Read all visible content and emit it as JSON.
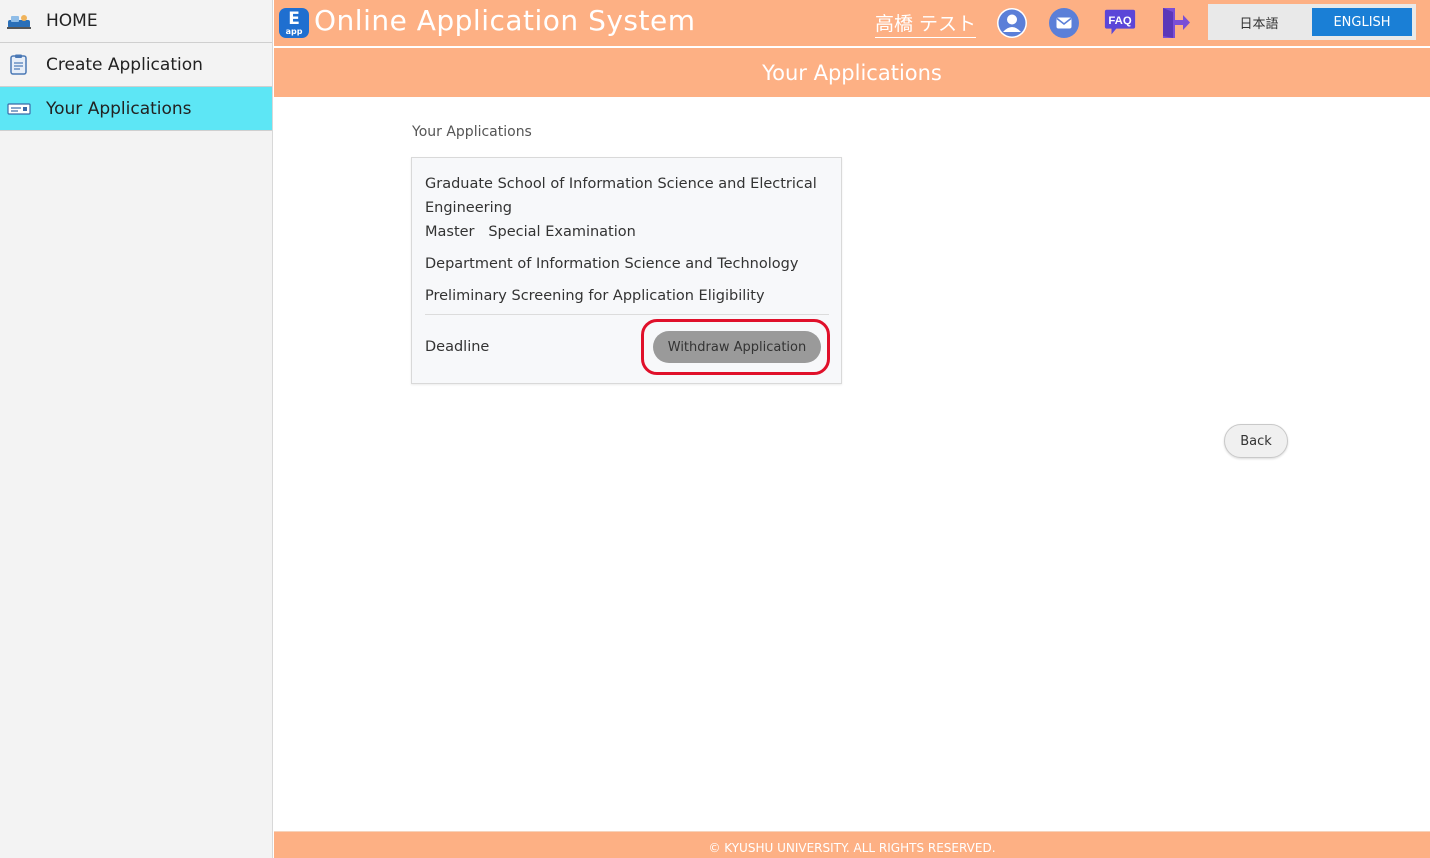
{
  "sidebar": {
    "items": [
      {
        "label": "HOME",
        "icon": "home-icon"
      },
      {
        "label": "Create Application",
        "icon": "create-application-icon"
      },
      {
        "label": "Your Applications",
        "icon": "your-applications-icon",
        "active": true
      }
    ]
  },
  "header": {
    "logo_letter": "E",
    "logo_sub": "app",
    "title": "Online Application System",
    "user_name": "高橋 テスト",
    "icons": [
      "user-icon",
      "mail-icon",
      "faq-icon",
      "logout-icon"
    ],
    "faq_label": "FAQ",
    "lang_japanese": "日本語",
    "lang_english": "ENGLISH"
  },
  "page": {
    "title": "Your Applications",
    "section_label": "Your Applications"
  },
  "application": {
    "school": "Graduate School of Information Science and Electrical Engineering",
    "course": "Master   Special Examination",
    "department": "Department of Information Science and Technology",
    "screening": "Preliminary Screening for Application Eligibility",
    "deadline_label": "Deadline",
    "withdraw_label": "Withdraw Application"
  },
  "back_label": "Back",
  "footer": {
    "text": "© KYUSHU UNIVERSITY. ALL RIGHTS RESERVED."
  },
  "colors": {
    "header_bg": "#fdb084",
    "active_item": "#5de6f5",
    "english_button": "#1a7fd6",
    "highlight_ring": "#e0102a",
    "withdraw_button": "#9a9a9a"
  }
}
